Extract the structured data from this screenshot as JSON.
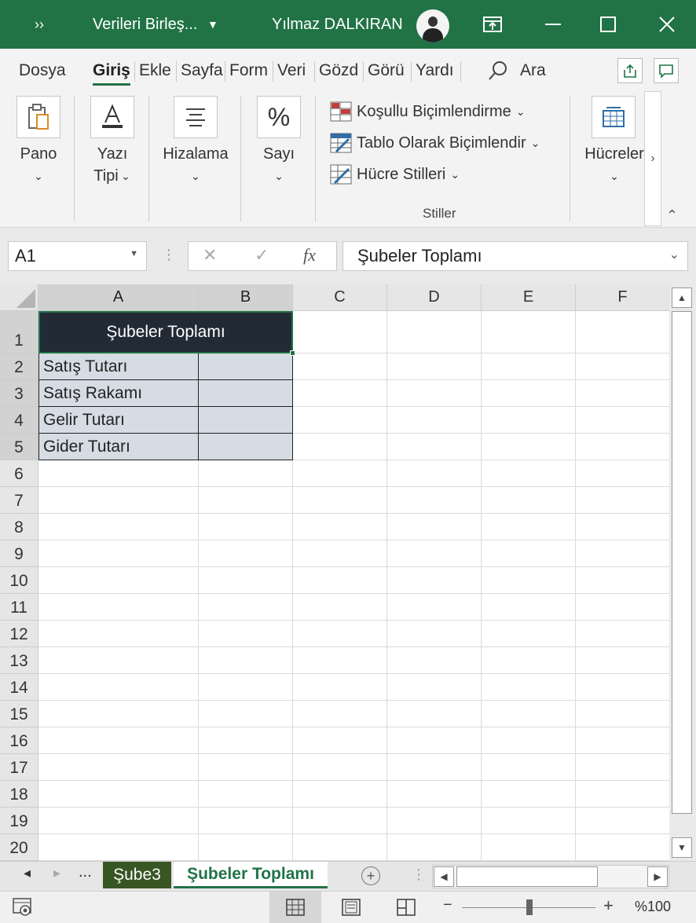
{
  "titlebar": {
    "overflow": "››",
    "document_title": "Verileri Birleş...",
    "user_name": "Yılmaz DALKIRAN"
  },
  "ribbon": {
    "tabs": [
      "Dosya",
      "Giriş",
      "Ekle",
      "Sayfa",
      "Form",
      "Veri",
      "Gözd",
      "Görü",
      "Yardı"
    ],
    "search_label": "Ara",
    "groups": {
      "pano": "Pano",
      "yazi_tipi_1": "Yazı",
      "yazi_tipi_2": "Tipi",
      "hizalama": "Hizalama",
      "sayi": "Sayı",
      "hucreler": "Hücreler"
    },
    "styles": {
      "conditional": "Koşullu Biçimlendirme",
      "as_table": "Tablo Olarak Biçimlendir",
      "cell_styles": "Hücre Stilleri",
      "group_label": "Stiller"
    }
  },
  "formula_bar": {
    "name_box": "A1",
    "fx": "fx",
    "content": "Şubeler Toplamı"
  },
  "grid": {
    "columns": [
      "A",
      "B",
      "C",
      "D",
      "E",
      "F"
    ],
    "rows": [
      "1",
      "2",
      "3",
      "4",
      "5",
      "6",
      "7",
      "8",
      "9",
      "10",
      "11",
      "12",
      "13",
      "14",
      "15",
      "16",
      "17",
      "18",
      "19",
      "20"
    ],
    "merged_title": "Şubeler Toplamı",
    "labels": [
      "Satış Tutarı",
      "Satış Rakamı",
      "Gelir Tutarı",
      "Gider Tutarı"
    ],
    "header_fill": "#222a35",
    "data_fill": "#d6dce4"
  },
  "sheets": {
    "more": "...",
    "tabs": [
      "Şube3",
      "Şubeler Toplamı"
    ],
    "active": "Şubeler Toplamı"
  },
  "status": {
    "zoom": "%100",
    "zoom_minus": "−",
    "zoom_plus": "+"
  },
  "colors": {
    "brand_green": "#217346"
  }
}
